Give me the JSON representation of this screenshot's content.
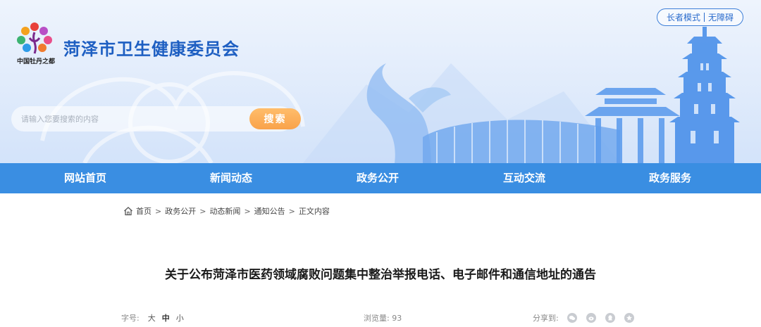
{
  "header": {
    "site_title": "菏泽市卫生健康委员会",
    "logo_caption": "中国牡丹之都",
    "elder_mode_label": "长者模式",
    "accessibility_label": "无障碍",
    "accent_color": "#3a8ee2"
  },
  "search": {
    "placeholder": "请输入您要搜索的内容",
    "button_label": "搜索"
  },
  "nav": {
    "items": [
      {
        "label": "网站首页"
      },
      {
        "label": "新闻动态"
      },
      {
        "label": "政务公开"
      },
      {
        "label": "互动交流"
      },
      {
        "label": "政务服务"
      }
    ]
  },
  "breadcrumb": {
    "home": "首页",
    "items": [
      "政务公开",
      "动态新闻",
      "通知公告"
    ],
    "current": "正文内容",
    "separator": ">"
  },
  "article": {
    "title": "关于公布菏泽市医药领域腐败问题集中整治举报电话、电子邮件和通信地址的通告",
    "font_size_label": "字号:",
    "font_size_large": "大",
    "font_size_medium": "中",
    "font_size_small": "小",
    "views_label": "浏览量:",
    "views": "93",
    "share_label": "分享到:",
    "share_icons": [
      "wechat-icon",
      "weibo-icon",
      "qq-icon",
      "qzone-icon"
    ]
  }
}
